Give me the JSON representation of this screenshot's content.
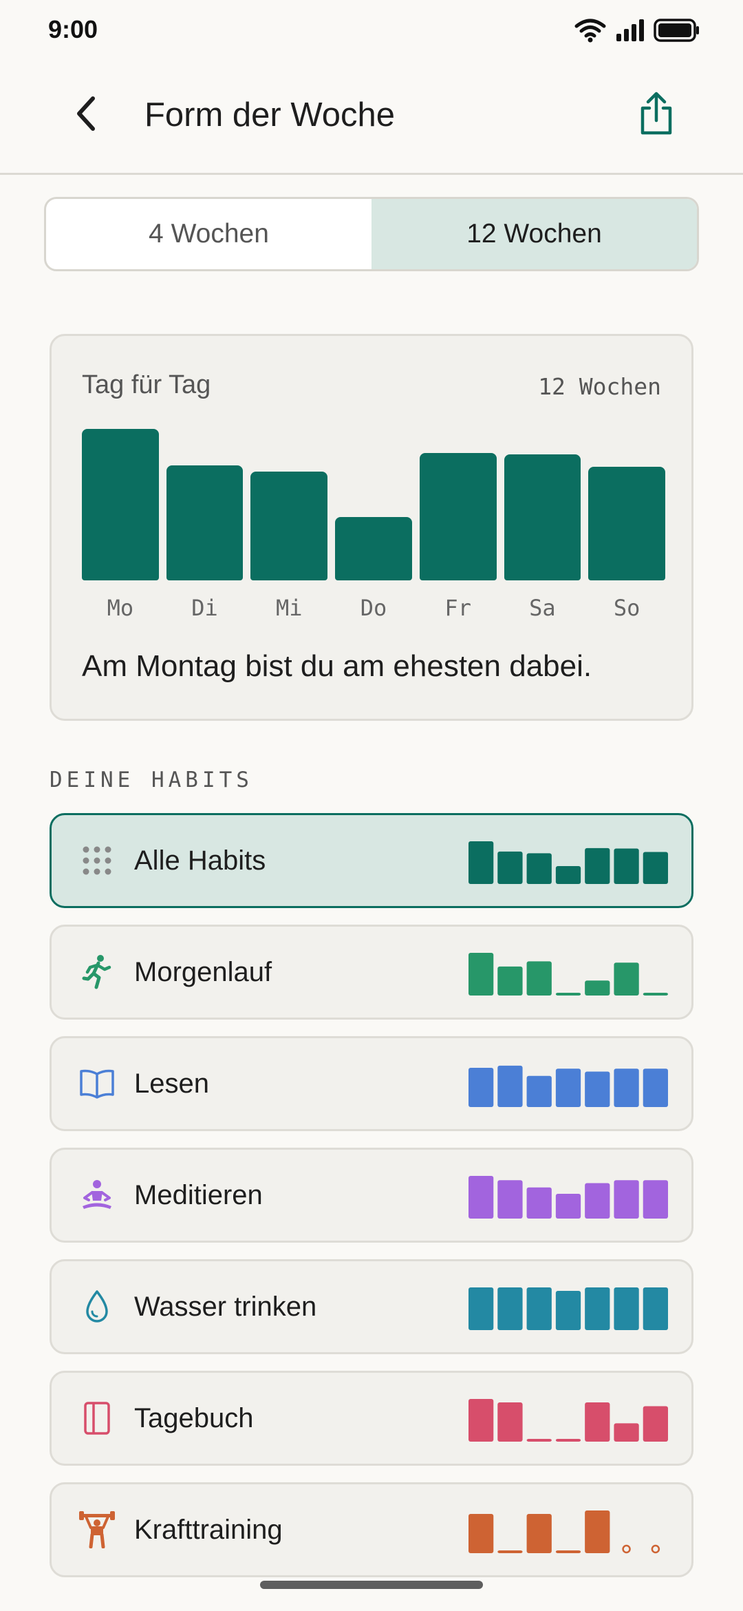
{
  "status": {
    "time": "9:00"
  },
  "header": {
    "title": "Form der Woche"
  },
  "range_toggle": {
    "options": [
      "4 Wochen",
      "12 Wochen"
    ],
    "selected": "12 Wochen"
  },
  "weekday_card": {
    "title": "Tag für Tag",
    "meta": "12 Wochen",
    "insight": "Am Montag bist du am ehesten dabei."
  },
  "chart_data": {
    "type": "bar",
    "categories": [
      "Mo",
      "Di",
      "Mi",
      "Do",
      "Fr",
      "Sa",
      "So"
    ],
    "values": [
      100,
      76,
      72,
      42,
      84,
      83,
      75
    ]
  },
  "habits_section": {
    "label": "DEINE HABITS",
    "items": [
      {
        "name": "Alle Habits",
        "icon": "grid-dots-icon",
        "color": "#0B6E60",
        "selected": true,
        "week": [
          100,
          76,
          72,
          42,
          84,
          83,
          75
        ]
      },
      {
        "name": "Morgenlauf",
        "icon": "runner-icon",
        "color": "#279769",
        "selected": false,
        "week": [
          100,
          68,
          80,
          5,
          35,
          77,
          5
        ]
      },
      {
        "name": "Lesen",
        "icon": "book-icon",
        "color": "#4B7FD6",
        "selected": false,
        "week": [
          92,
          97,
          73,
          90,
          83,
          90,
          90
        ]
      },
      {
        "name": "Meditieren",
        "icon": "meditation-icon",
        "color": "#A264DE",
        "selected": false,
        "week": [
          100,
          90,
          73,
          58,
          83,
          90,
          90
        ]
      },
      {
        "name": "Wasser trinken",
        "icon": "water-drop-icon",
        "color": "#2389A3",
        "selected": false,
        "week": [
          100,
          100,
          100,
          92,
          100,
          100,
          100
        ]
      },
      {
        "name": "Tagebuch",
        "icon": "journal-icon",
        "color": "#D74E6B",
        "selected": false,
        "week": [
          100,
          92,
          5,
          5,
          92,
          43,
          83
        ]
      },
      {
        "name": "Krafttraining",
        "icon": "weightlifter-icon",
        "color": "#CE6333",
        "selected": false,
        "week": [
          92,
          5,
          92,
          5,
          100,
          0,
          0
        ]
      }
    ]
  }
}
